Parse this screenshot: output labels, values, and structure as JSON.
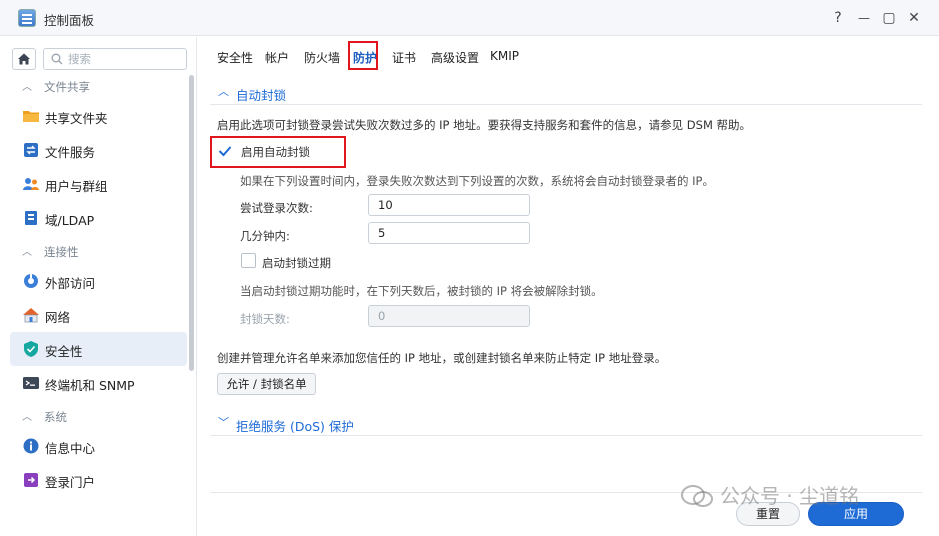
{
  "window": {
    "title": "控制面板",
    "help_label": "?",
    "minimize_label": "—",
    "maximize_label": "▢",
    "close_label": "✕"
  },
  "sidebar": {
    "search_placeholder": "搜索",
    "sections": [
      {
        "label": "文件共享",
        "items": [
          {
            "label": "共享文件夹",
            "icon": "folder-icon"
          },
          {
            "label": "文件服务",
            "icon": "file-service-icon"
          },
          {
            "label": "用户与群组",
            "icon": "users-icon"
          },
          {
            "label": "域/LDAP",
            "icon": "domain-icon"
          }
        ]
      },
      {
        "label": "连接性",
        "items": [
          {
            "label": "外部访问",
            "icon": "external-access-icon"
          },
          {
            "label": "网络",
            "icon": "network-icon"
          },
          {
            "label": "安全性",
            "icon": "shield-icon",
            "active": true
          },
          {
            "label": "终端机和 SNMP",
            "icon": "terminal-icon"
          }
        ]
      },
      {
        "label": "系统",
        "items": [
          {
            "label": "信息中心",
            "icon": "info-icon"
          },
          {
            "label": "登录门户",
            "icon": "login-portal-icon"
          }
        ]
      }
    ]
  },
  "tabs": [
    "安全性",
    "帐户",
    "防火墙",
    "防护",
    "证书",
    "高级设置",
    "KMIP"
  ],
  "active_tab": "防护",
  "auto_block": {
    "section_title": "自动封锁",
    "description": "启用此选项可封锁登录尝试失败次数过多的 IP 地址。要获得支持服务和套件的信息，请参见 DSM 帮助。",
    "enable_label": "启用自动封锁",
    "enabled": true,
    "condition_text": "如果在下列设置时间内，登录失败次数达到下列设置的次数，系统将会自动封锁登录者的 IP。",
    "attempts_label": "尝试登录次数:",
    "attempts_value": "10",
    "minutes_label": "几分钟内:",
    "minutes_value": "5",
    "expire_label": "启动封锁过期",
    "expire_enabled": false,
    "expire_text": "当启动封锁过期功能时，在下列天数后，被封锁的 IP 将会被解除封锁。",
    "days_label": "封锁天数:",
    "days_value": "0",
    "allowlist_text": "创建并管理允许名单来添加您信任的 IP 地址，或创建封锁名单来防止特定 IP 地址登录。",
    "allowlist_button": "允许 / 封锁名单"
  },
  "dos": {
    "section_title": "拒绝服务 (DoS) 保护"
  },
  "footer": {
    "reset_label": "重置",
    "apply_label": "应用"
  },
  "watermark": "公众号 · 尘道铭",
  "colors": {
    "accent": "#1e6bd6",
    "highlight_box": "#e0161c"
  }
}
